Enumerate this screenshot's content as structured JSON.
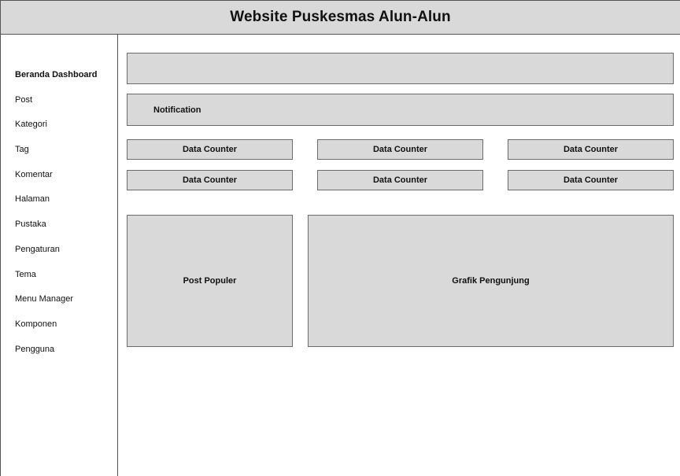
{
  "header": {
    "title": "Website Puskesmas Alun-Alun"
  },
  "sidebar": {
    "items": [
      {
        "label": "Beranda Dashboard",
        "active": true
      },
      {
        "label": "Post"
      },
      {
        "label": "Kategori"
      },
      {
        "label": "Tag"
      },
      {
        "label": "Komentar"
      },
      {
        "label": "Halaman"
      },
      {
        "label": "Pustaka"
      },
      {
        "label": "Pengaturan"
      },
      {
        "label": "Tema"
      },
      {
        "label": "Menu Manager"
      },
      {
        "label": "Komponen"
      },
      {
        "label": "Pengguna"
      }
    ]
  },
  "main": {
    "notification": "Notification",
    "counters": [
      "Data Counter",
      "Data Counter",
      "Data Counter",
      "Data Counter",
      "Data Counter",
      "Data Counter"
    ],
    "post_populer": "Post Populer",
    "grafik_pengunjung": "Grafik Pengunjung"
  },
  "colors": {
    "panel": "#d9d9d9",
    "border": "#555555",
    "background": "#ffffff"
  }
}
